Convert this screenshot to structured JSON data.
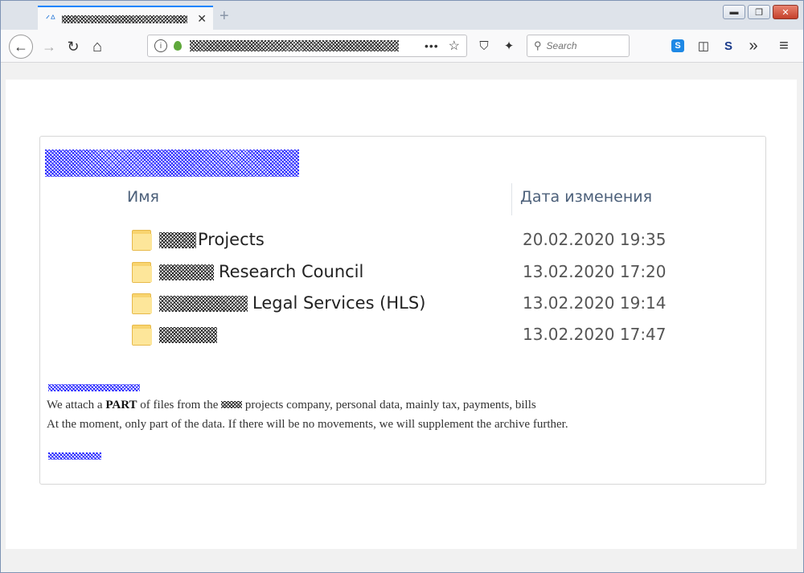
{
  "browser": {
    "tab": {
      "title": "",
      "close_glyph": "✕"
    },
    "new_tab_glyph": "+",
    "window_controls": {
      "minimize": "▬",
      "maximize": "❐",
      "close": "✕"
    },
    "nav": {
      "back": "←",
      "forward": "→",
      "reload": "↻",
      "home": "⌂"
    },
    "url": {
      "info": "i",
      "menu": "•••",
      "star": "☆"
    },
    "search": {
      "placeholder": "Search",
      "value": ""
    },
    "toolbar": {
      "shield": "⛉",
      "magic": "✦",
      "overflow": "»",
      "menu": "≡",
      "sidebar": "◫",
      "s_app": "S",
      "skype": "S"
    }
  },
  "page": {
    "explorer": {
      "columns": {
        "name": "Имя",
        "date": "Дата изменения"
      },
      "rows": [
        {
          "name": "Projects",
          "date": "20.02.2020 19:35"
        },
        {
          "name": "Research Council",
          "date": "13.02.2020 17:20"
        },
        {
          "name": "Legal Services (HLS)",
          "date": "13.02.2020 19:14"
        },
        {
          "name": "",
          "date": "13.02.2020 17:47"
        }
      ]
    },
    "message": {
      "line1_a": "We attach a ",
      "line1_bold": "PART",
      "line1_b": " of files from the",
      "line1_c": "projects company, personal data, mainly tax, payments, bills",
      "line2": "At the moment, only part of the data. If there will be no movements, we will supplement the archive further."
    }
  },
  "colors": {
    "tab_accent": "#0a84ff",
    "titlebar": "#dee3ea",
    "folder": "#f8d46f",
    "redaction": "#1a1aff"
  }
}
